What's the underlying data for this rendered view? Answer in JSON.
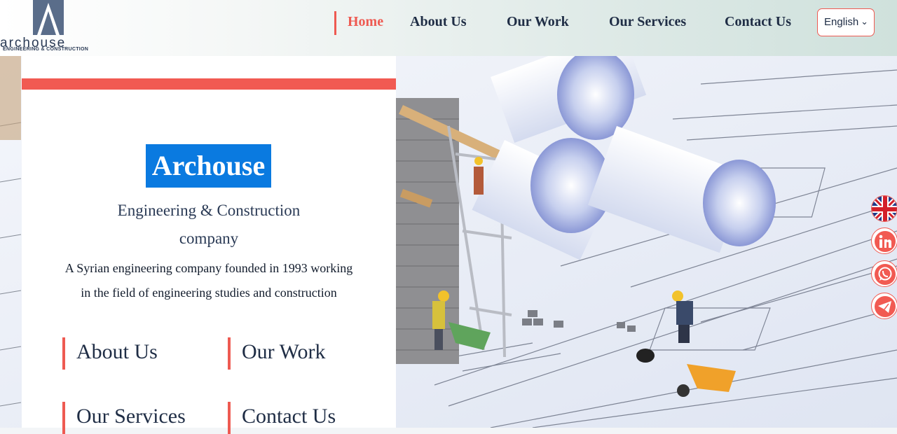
{
  "logo": {
    "word": "archouse",
    "subtitle": "ENGINEERING & CONSTRUCTION"
  },
  "nav": {
    "items": [
      {
        "label": "Home",
        "active": true
      },
      {
        "label": "About Us"
      },
      {
        "label": "Our Work"
      },
      {
        "label": "Our Services"
      },
      {
        "label": "Contact Us"
      }
    ]
  },
  "language": {
    "selected": "English"
  },
  "hero": {
    "brand": "Archouse",
    "tagline_line1": "Engineering  & Construction",
    "tagline_line2": "company",
    "description_line1": "A Syrian engineering company founded in 1993 working",
    "description_line2": "in the field of engineering studies and construction",
    "links": [
      "About Us",
      "Our Work",
      "Our Services",
      "Contact Us"
    ]
  },
  "social": [
    "uk-flag-icon",
    "linkedin-icon",
    "whatsapp-icon",
    "telegram-icon"
  ],
  "colors": {
    "accent": "#ee5a52",
    "brand_highlight": "#0a7ae0",
    "text_dark": "#1f2d45"
  }
}
